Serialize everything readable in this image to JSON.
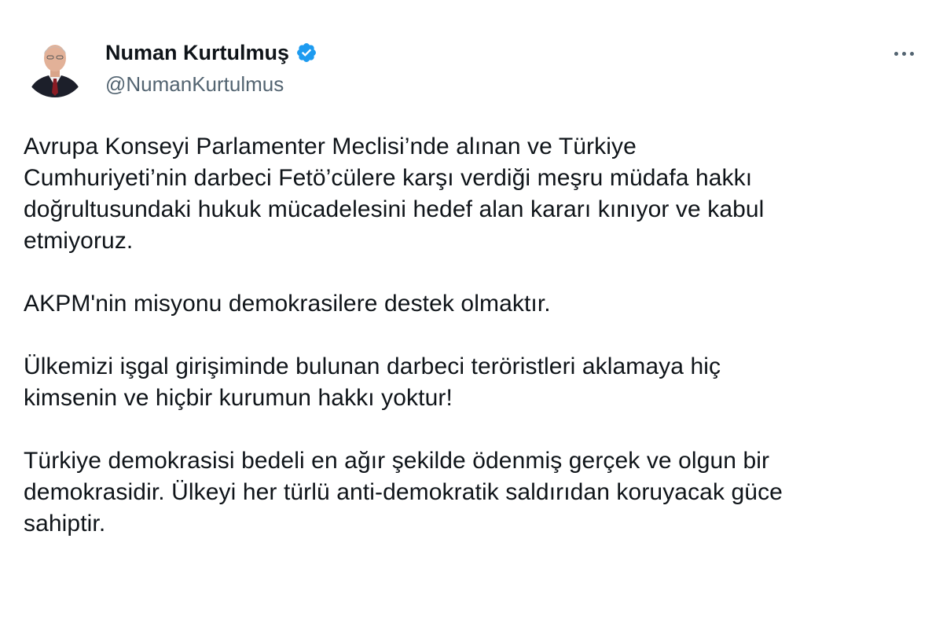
{
  "tweet": {
    "author": {
      "display_name": "Numan Kurtulmuş",
      "handle": "@NumanKurtulmus",
      "verified": true,
      "verified_icon": "verified-badge-icon",
      "avatar_icon": "profile-photo"
    },
    "more_icon": "more-options-icon",
    "paragraphs": [
      "Avrupa Konseyi Parlamenter Meclisi’nde alınan ve Türkiye\nCumhuriyeti’nin darbeci Fetö’cülere karşı verdiği meşru müdafa hakkı\ndoğrultusundaki hukuk mücadelesini hedef alan kararı kınıyor ve kabul\netmiyoruz.",
      "AKPM'nin misyonu demokrasilere destek olmaktır.",
      "Ülkemizi işgal girişiminde bulunan darbeci teröristleri aklamaya hiç\nkimsenin ve hiçbir kurumun hakkı yoktur!",
      "Türkiye demokrasisi bedeli en ağır şekilde ödenmiş gerçek ve olgun bir\ndemokrasidir. Ülkeyi her türlü anti-demokratik saldırıdan koruyacak güce\nsahiptir."
    ]
  },
  "colors": {
    "text": "#0f1419",
    "secondary": "#536471",
    "verified": "#1d9bf0"
  }
}
